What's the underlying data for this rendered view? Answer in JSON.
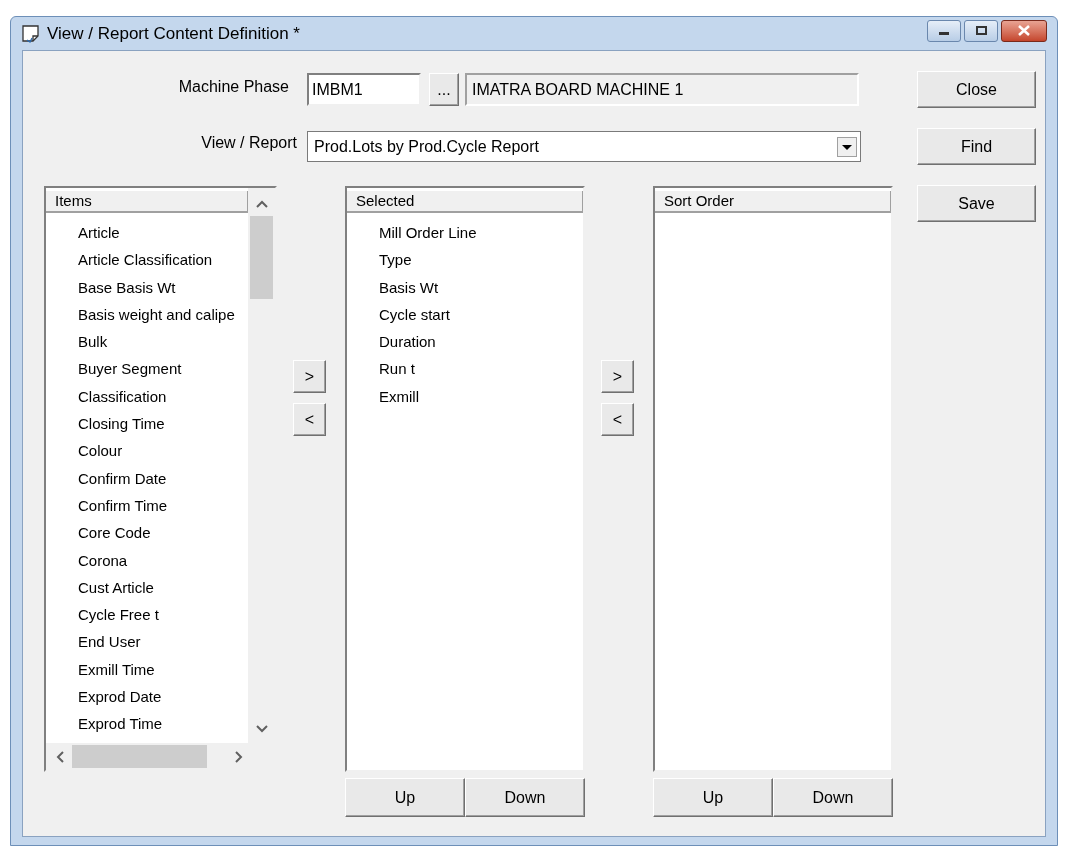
{
  "window": {
    "title": "View / Report Content Definition *"
  },
  "machine_phase": {
    "label": "Machine Phase",
    "code": "IMBM1",
    "browse_button": "...",
    "description": "IMATRA BOARD MACHINE 1"
  },
  "view_report": {
    "label": "View / Report",
    "value": "Prod.Lots by Prod.Cycle Report"
  },
  "buttons": [
    "Close",
    "Find",
    "Save"
  ],
  "items_list": {
    "header": "Items",
    "rows": [
      "Article",
      "Article Classification",
      "Base Basis Wt",
      "Basis weight and calipe",
      "Bulk",
      "Buyer Segment",
      "Classification",
      "Closing Time",
      "Colour",
      "Confirm Date",
      "Confirm Time",
      "Core Code",
      "Corona",
      "Cust Article",
      "Cycle Free t",
      "End User",
      "Exmill Time",
      "Exprod Date",
      "Exprod Time"
    ]
  },
  "selected_list": {
    "add_button": ">",
    "remove_button": "<",
    "header": "Selected",
    "rows": [
      "Mill Order Line",
      "Type",
      "Basis Wt",
      "Cycle start",
      "Duration",
      "Run t",
      "Exmill"
    ],
    "up_button": "Up",
    "down_button": "Down"
  },
  "sort_order_list": {
    "add_button": ">",
    "remove_button": "<",
    "header": "Sort Order",
    "up_button": "Up",
    "down_button": "Down"
  }
}
